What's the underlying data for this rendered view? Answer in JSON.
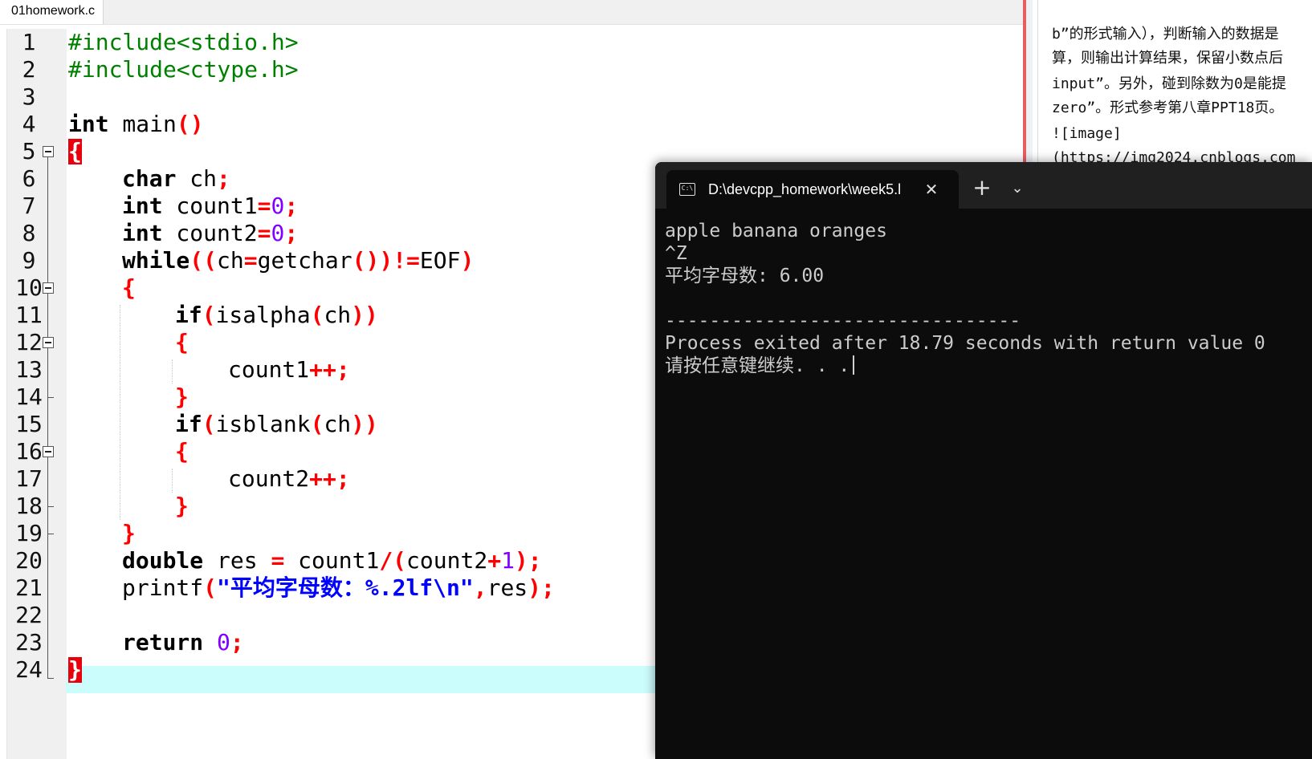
{
  "editor": {
    "tab_label": "01homework.c",
    "line_numbers": [
      "1",
      "2",
      "3",
      "4",
      "5",
      "6",
      "7",
      "8",
      "9",
      "10",
      "11",
      "12",
      "13",
      "14",
      "15",
      "16",
      "17",
      "18",
      "19",
      "20",
      "21",
      "22",
      "23",
      "24"
    ],
    "lines": {
      "l1": "#include<stdio.h>",
      "l2": "#include<ctype.h>",
      "l4_kw": "int",
      "l4_rest": " main",
      "l4_sym": "()",
      "l5_brace": "{",
      "l6_kw": "char",
      "l6_rest": " ch",
      "l6_sym": ";",
      "l7_kw": "int",
      "l7_rest": " count1",
      "l7_sym1": "=",
      "l7_num": "0",
      "l7_sym2": ";",
      "l8_kw": "int",
      "l8_rest": " count2",
      "l8_sym1": "=",
      "l8_num": "0",
      "l8_sym2": ";",
      "l9_kw": "while",
      "l9_s1": "((",
      "l9_t1": "ch",
      "l9_s2": "=",
      "l9_t2": "getchar",
      "l9_s3": "())!=",
      "l9_t3": "EOF",
      "l9_s4": ")",
      "l10_brace": "{",
      "l11_kw": "if",
      "l11_s1": "(",
      "l11_t1": "isalpha",
      "l11_s2": "(",
      "l11_t2": "ch",
      "l11_s3": "))",
      "l12_brace": "{",
      "l13_t": "count1",
      "l13_s": "++;",
      "l14_brace": "}",
      "l15_kw": "if",
      "l15_s1": "(",
      "l15_t1": "isblank",
      "l15_s2": "(",
      "l15_t2": "ch",
      "l15_s3": "))",
      "l16_brace": "{",
      "l17_t": "count2",
      "l17_s": "++;",
      "l18_brace": "}",
      "l19_brace": "}",
      "l20_kw": "double",
      "l20_t1": " res ",
      "l20_s1": "=",
      "l20_t2": " count1",
      "l20_s2": "/(",
      "l20_t3": "count2",
      "l20_s3": "+",
      "l20_num": "1",
      "l20_s4": ");",
      "l21_t1": "printf",
      "l21_s1": "(",
      "l21_str": "\"平均字母数：%.2lf\\n\"",
      "l21_s2": ",",
      "l21_t2": "res",
      "l21_s3": ");",
      "l23_kw": "return",
      "l23_sp": " ",
      "l23_num": "0",
      "l23_s": ";",
      "l24_brace": "}"
    }
  },
  "doc": {
    "lines": [
      "b”的形式输入），判断输入的数据是",
      "算，则输出计算结果，保留小数点后",
      "input”。另外，碰到除数为0是能提",
      "zero”。形式参考第八章PPT18页。",
      "![image]",
      "(https://img2024.cnblogs.com"
    ]
  },
  "terminal": {
    "tab_title": "D:\\devcpp_homework\\week5.l",
    "icon_text": "C:\\",
    "close_glyph": "✕",
    "new_tab_glyph": "+",
    "dropdown_glyph": "⌄",
    "output": [
      "apple banana oranges",
      "^Z",
      "平均字母数: 6.00",
      "",
      "--------------------------------",
      "Process exited after 18.79 seconds with return value 0",
      "请按任意键继续. . ."
    ]
  }
}
